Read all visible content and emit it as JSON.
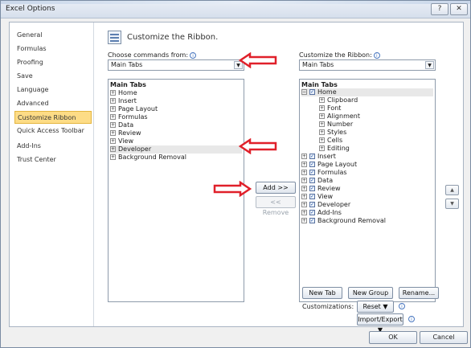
{
  "window": {
    "title": "Excel Options",
    "help": "?",
    "close": "✕"
  },
  "sidebar": {
    "items": [
      {
        "label": "General"
      },
      {
        "label": "Formulas"
      },
      {
        "label": "Proofing"
      },
      {
        "label": "Save"
      },
      {
        "label": "Language"
      },
      {
        "label": "Advanced"
      },
      {
        "label": "Customize Ribbon",
        "selected": true
      },
      {
        "label": "Quick Access Toolbar"
      },
      {
        "label": "Add-Ins"
      },
      {
        "label": "Trust Center"
      }
    ]
  },
  "main": {
    "header_title": "Customize the Ribbon.",
    "choose_label": "Choose commands from:",
    "choose_value": "Main Tabs",
    "customize_label": "Customize the Ribbon:",
    "customize_value": "Main Tabs",
    "left_list": {
      "header": "Main Tabs",
      "items": [
        "Home",
        "Insert",
        "Page Layout",
        "Formulas",
        "Data",
        "Review",
        "View",
        "Developer",
        "Background Removal"
      ]
    },
    "right_list": {
      "header": "Main Tabs",
      "home": "Home",
      "home_groups": [
        "Clipboard",
        "Font",
        "Alignment",
        "Number",
        "Styles",
        "Cells",
        "Editing"
      ],
      "tabs": [
        "Insert",
        "Page Layout",
        "Formulas",
        "Data",
        "Review",
        "View",
        "Developer",
        "Add-Ins",
        "Background Removal"
      ]
    },
    "add_button": "Add >>",
    "remove_button": "<< Remove",
    "new_tab": "New Tab",
    "new_group": "New Group",
    "rename": "Rename...",
    "customizations_label": "Customizations:",
    "reset_button": "Reset ▼",
    "import_export_button": "Import/Export ▼"
  },
  "footer": {
    "ok": "OK",
    "cancel": "Cancel"
  },
  "colors": {
    "selected_nav": "#fddc86",
    "annotation_arrow": "#e0202a"
  }
}
